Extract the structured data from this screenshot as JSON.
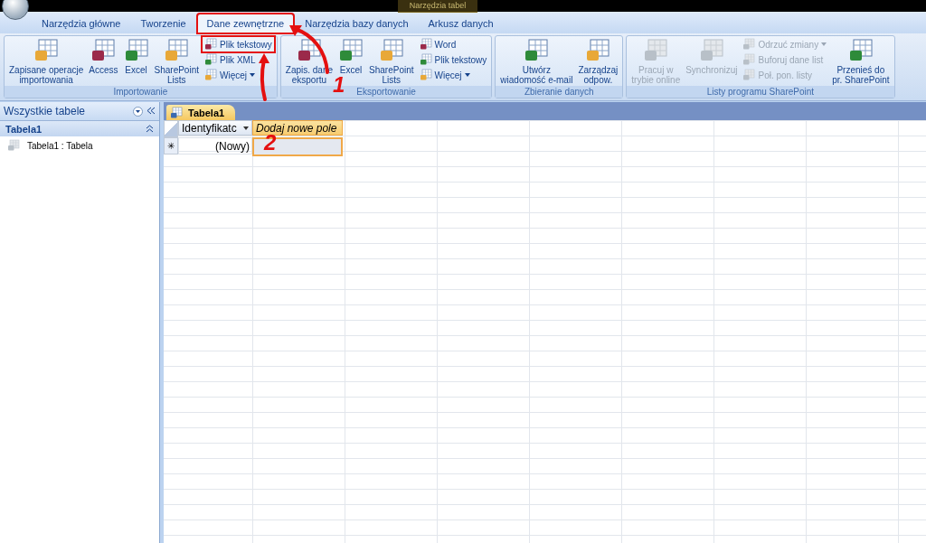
{
  "title_bar": {
    "contextual_tab": "Narzędzia tabel"
  },
  "tabs": [
    {
      "label": "Narzędzia główne",
      "selected": false,
      "highlighted": false
    },
    {
      "label": "Tworzenie",
      "selected": false,
      "highlighted": false
    },
    {
      "label": "Dane zewnętrzne",
      "selected": true,
      "highlighted": true
    },
    {
      "label": "Narzędzia bazy danych",
      "selected": false,
      "highlighted": false
    },
    {
      "label": "Arkusz danych",
      "selected": false,
      "highlighted": false
    }
  ],
  "ribbon_groups": [
    {
      "title": "Importowanie",
      "items": [
        {
          "kind": "large",
          "label": "Zapisane operacje\nimportowania",
          "disabled": false
        },
        {
          "kind": "large",
          "label": "Access",
          "disabled": false
        },
        {
          "kind": "large",
          "label": "Excel",
          "disabled": false
        },
        {
          "kind": "large",
          "label": "SharePoint\nLists",
          "disabled": false
        },
        {
          "kind": "small",
          "label": "Plik tekstowy",
          "disabled": false,
          "highlighted": true
        },
        {
          "kind": "small",
          "label": "Plik XML",
          "disabled": false,
          "highlighted": false
        },
        {
          "kind": "small",
          "label": "Więcej",
          "disabled": false,
          "highlighted": false,
          "dropdown": true
        }
      ]
    },
    {
      "title": "Eksportowanie",
      "items": [
        {
          "kind": "large",
          "label": "Zapis. dane\neksportu",
          "disabled": false
        },
        {
          "kind": "large",
          "label": "Excel",
          "disabled": false
        },
        {
          "kind": "large",
          "label": "SharePoint\nLists",
          "disabled": false
        },
        {
          "kind": "small",
          "label": "Word",
          "disabled": false,
          "highlighted": false
        },
        {
          "kind": "small",
          "label": "Plik tekstowy",
          "disabled": false,
          "highlighted": false
        },
        {
          "kind": "small",
          "label": "Więcej",
          "disabled": false,
          "highlighted": false,
          "dropdown": true
        }
      ]
    },
    {
      "title": "Zbieranie danych",
      "items": [
        {
          "kind": "large",
          "label": "Utwórz\nwiadomość e-mail",
          "disabled": false
        },
        {
          "kind": "large",
          "label": "Zarządzaj\nodpow.",
          "disabled": false
        }
      ]
    },
    {
      "title": "Listy programu SharePoint",
      "items": [
        {
          "kind": "large",
          "label": "Pracuj w\ntrybie online",
          "disabled": true
        },
        {
          "kind": "large",
          "label": "Synchronizuj",
          "disabled": true
        },
        {
          "kind": "small",
          "label": "Odrzuć zmiany",
          "disabled": true,
          "highlighted": false,
          "dropdown": true
        },
        {
          "kind": "small",
          "label": "Buforuj dane list",
          "disabled": true,
          "highlighted": false
        },
        {
          "kind": "small",
          "label": "Poł. pon. listy",
          "disabled": true,
          "highlighted": false
        },
        {
          "kind": "large",
          "label": "Przenieś do\npr. SharePoint",
          "disabled": false
        }
      ]
    }
  ],
  "nav_pane": {
    "title": "Wszystkie tabele",
    "groups": [
      {
        "label": "Tabela1",
        "expanded": true,
        "children": [
          {
            "label": "Tabela1 : Tabela"
          }
        ]
      }
    ]
  },
  "document_tab": {
    "label": "Tabela1"
  },
  "datasheet": {
    "columns": [
      {
        "label": "Identyfikatc",
        "dropdown": true,
        "selected": false
      },
      {
        "label": "Dodaj nowe pole",
        "dropdown": false,
        "selected": true
      }
    ],
    "new_row": {
      "marker": "✳",
      "cells": [
        "(Nowy)",
        ""
      ]
    }
  },
  "annotations": [
    {
      "label": "1"
    },
    {
      "label": "2"
    }
  ]
}
